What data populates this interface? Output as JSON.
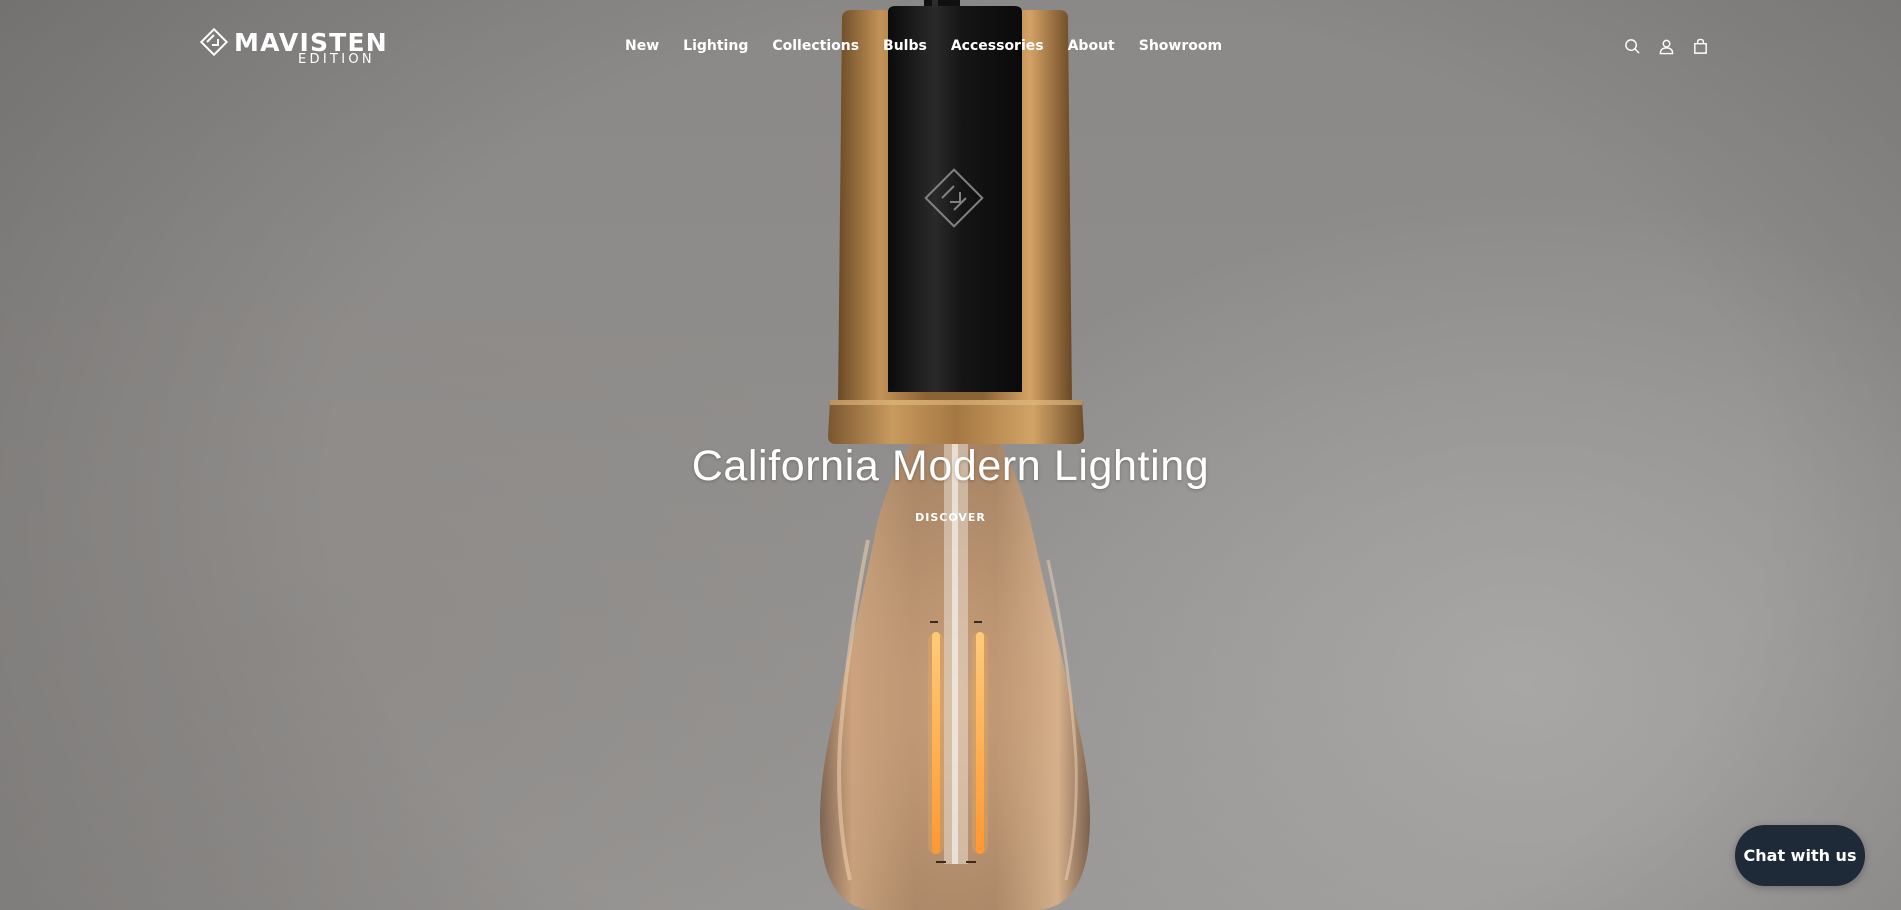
{
  "brand": {
    "name": "MAVISTEN",
    "sub": "EDITION"
  },
  "nav": {
    "items": [
      {
        "label": "New",
        "icon": null
      },
      {
        "label": "Lighting",
        "icon": null
      },
      {
        "label": "Collections",
        "icon": null
      },
      {
        "label": "Bulbs",
        "icon": null
      },
      {
        "label": "Accessories",
        "icon": null
      },
      {
        "label": "About",
        "icon": null
      },
      {
        "label": "Showroom",
        "icon": null
      }
    ]
  },
  "header_icons": [
    "search-icon",
    "account-icon",
    "cart-icon"
  ],
  "hero": {
    "title": "California Modern Lighting",
    "cta": "DISCOVER"
  },
  "chat": {
    "label": "Chat with us"
  },
  "colors": {
    "background": "#8f8d8b",
    "text": "#ffffff",
    "chat_bg": "#1f2a38",
    "brass": "#b07f45",
    "socket_black": "#121212",
    "bulb_glass": "#b48a64",
    "filament": "#ffb347"
  }
}
